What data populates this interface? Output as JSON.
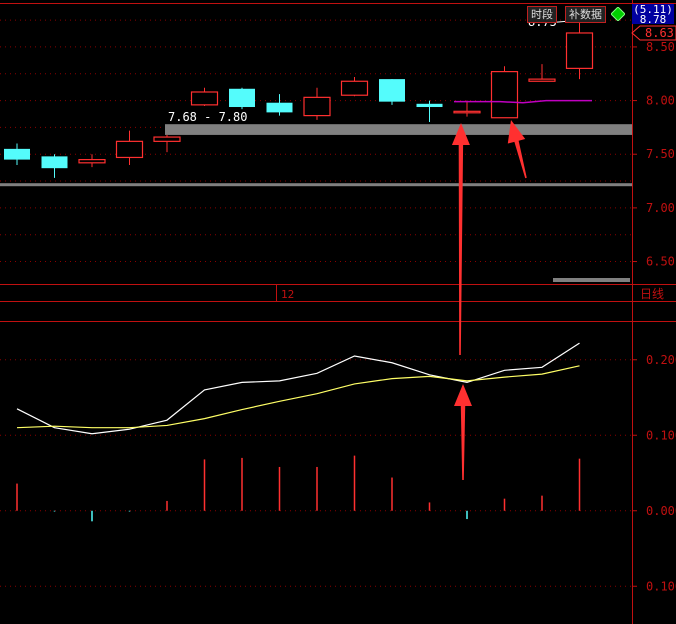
{
  "toolbar": {
    "time_button": "时段",
    "data_button": "补数据",
    "price_top": "(5.11)",
    "price_bottom": "8.78"
  },
  "colors": {
    "up": "#ff3030",
    "down": "#54fcfc",
    "grid": "#8b0000",
    "axis": "#c01010",
    "band": "#808080",
    "fast_line": "#ffffff",
    "slow_line": "#ffff66",
    "avg_line": "#c000c0",
    "arrow": "#ff3030",
    "price_tag": "#ff3030"
  },
  "chart_data": [
    {
      "type": "candlestick",
      "panel": "price",
      "ylim": [
        6.3,
        8.9
      ],
      "y_ticks": [
        "8.50",
        "8.00",
        "7.50",
        "7.00",
        "6.50"
      ],
      "current_price_label": "8.63",
      "period_label": "日线",
      "x_marker_label": "12",
      "band_label": "7.68 - 7.80",
      "high_label": "8.75",
      "candles": [
        {
          "o": 7.55,
          "h": 7.6,
          "l": 7.4,
          "c": 7.45
        },
        {
          "o": 7.48,
          "h": 7.5,
          "l": 7.28,
          "c": 7.37
        },
        {
          "o": 7.42,
          "h": 7.5,
          "l": 7.38,
          "c": 7.45
        },
        {
          "o": 7.47,
          "h": 7.72,
          "l": 7.4,
          "c": 7.62
        },
        {
          "o": 7.62,
          "h": 7.68,
          "l": 7.52,
          "c": 7.66
        },
        {
          "o": 7.96,
          "h": 8.12,
          "l": 7.95,
          "c": 8.08
        },
        {
          "o": 8.11,
          "h": 8.12,
          "l": 7.92,
          "c": 7.94
        },
        {
          "o": 7.98,
          "h": 8.06,
          "l": 7.86,
          "c": 7.89
        },
        {
          "o": 7.86,
          "h": 8.12,
          "l": 7.82,
          "c": 8.03
        },
        {
          "o": 8.05,
          "h": 8.22,
          "l": 8.04,
          "c": 8.18
        },
        {
          "o": 8.2,
          "h": 8.2,
          "l": 7.96,
          "c": 7.99
        },
        {
          "o": 7.97,
          "h": 8.0,
          "l": 7.8,
          "c": 7.94
        },
        {
          "o": 7.9,
          "h": 8.0,
          "l": 7.85,
          "c": 7.9
        },
        {
          "o": 7.84,
          "h": 8.32,
          "l": 7.84,
          "c": 8.27
        },
        {
          "o": 8.18,
          "h": 8.34,
          "l": 8.18,
          "c": 8.2
        },
        {
          "o": 8.3,
          "h": 8.75,
          "l": 8.2,
          "c": 8.63
        }
      ],
      "average_line": {
        "from_index": 12,
        "values": [
          7.99,
          7.99,
          7.99,
          7.98,
          8.0,
          8.0,
          8.0
        ]
      },
      "bands": [
        {
          "low": 7.68,
          "high": 7.78
        },
        {
          "low": 7.21,
          "high": 7.23
        }
      ]
    },
    {
      "type": "line",
      "panel": "indicator",
      "ylim": [
        -0.15,
        0.25
      ],
      "y_ticks": [
        "0.200",
        "0.100",
        "0.000",
        "0.100"
      ],
      "series": [
        {
          "color": "fast_line",
          "values": [
            0.135,
            0.11,
            0.102,
            0.108,
            0.12,
            0.16,
            0.17,
            0.172,
            0.182,
            0.205,
            0.196,
            0.18,
            0.17,
            0.186,
            0.19,
            0.222
          ]
        },
        {
          "color": "slow_line",
          "values": [
            0.11,
            0.112,
            0.11,
            0.11,
            0.113,
            0.122,
            0.134,
            0.145,
            0.155,
            0.168,
            0.175,
            0.178,
            0.172,
            0.177,
            0.181,
            0.192
          ]
        }
      ],
      "histogram": [
        0.036,
        -0.001,
        -0.014,
        -0.001,
        0.013,
        0.068,
        0.07,
        0.058,
        0.058,
        0.073,
        0.044,
        0.011,
        -0.011,
        0.016,
        0.02,
        0.069
      ]
    }
  ]
}
